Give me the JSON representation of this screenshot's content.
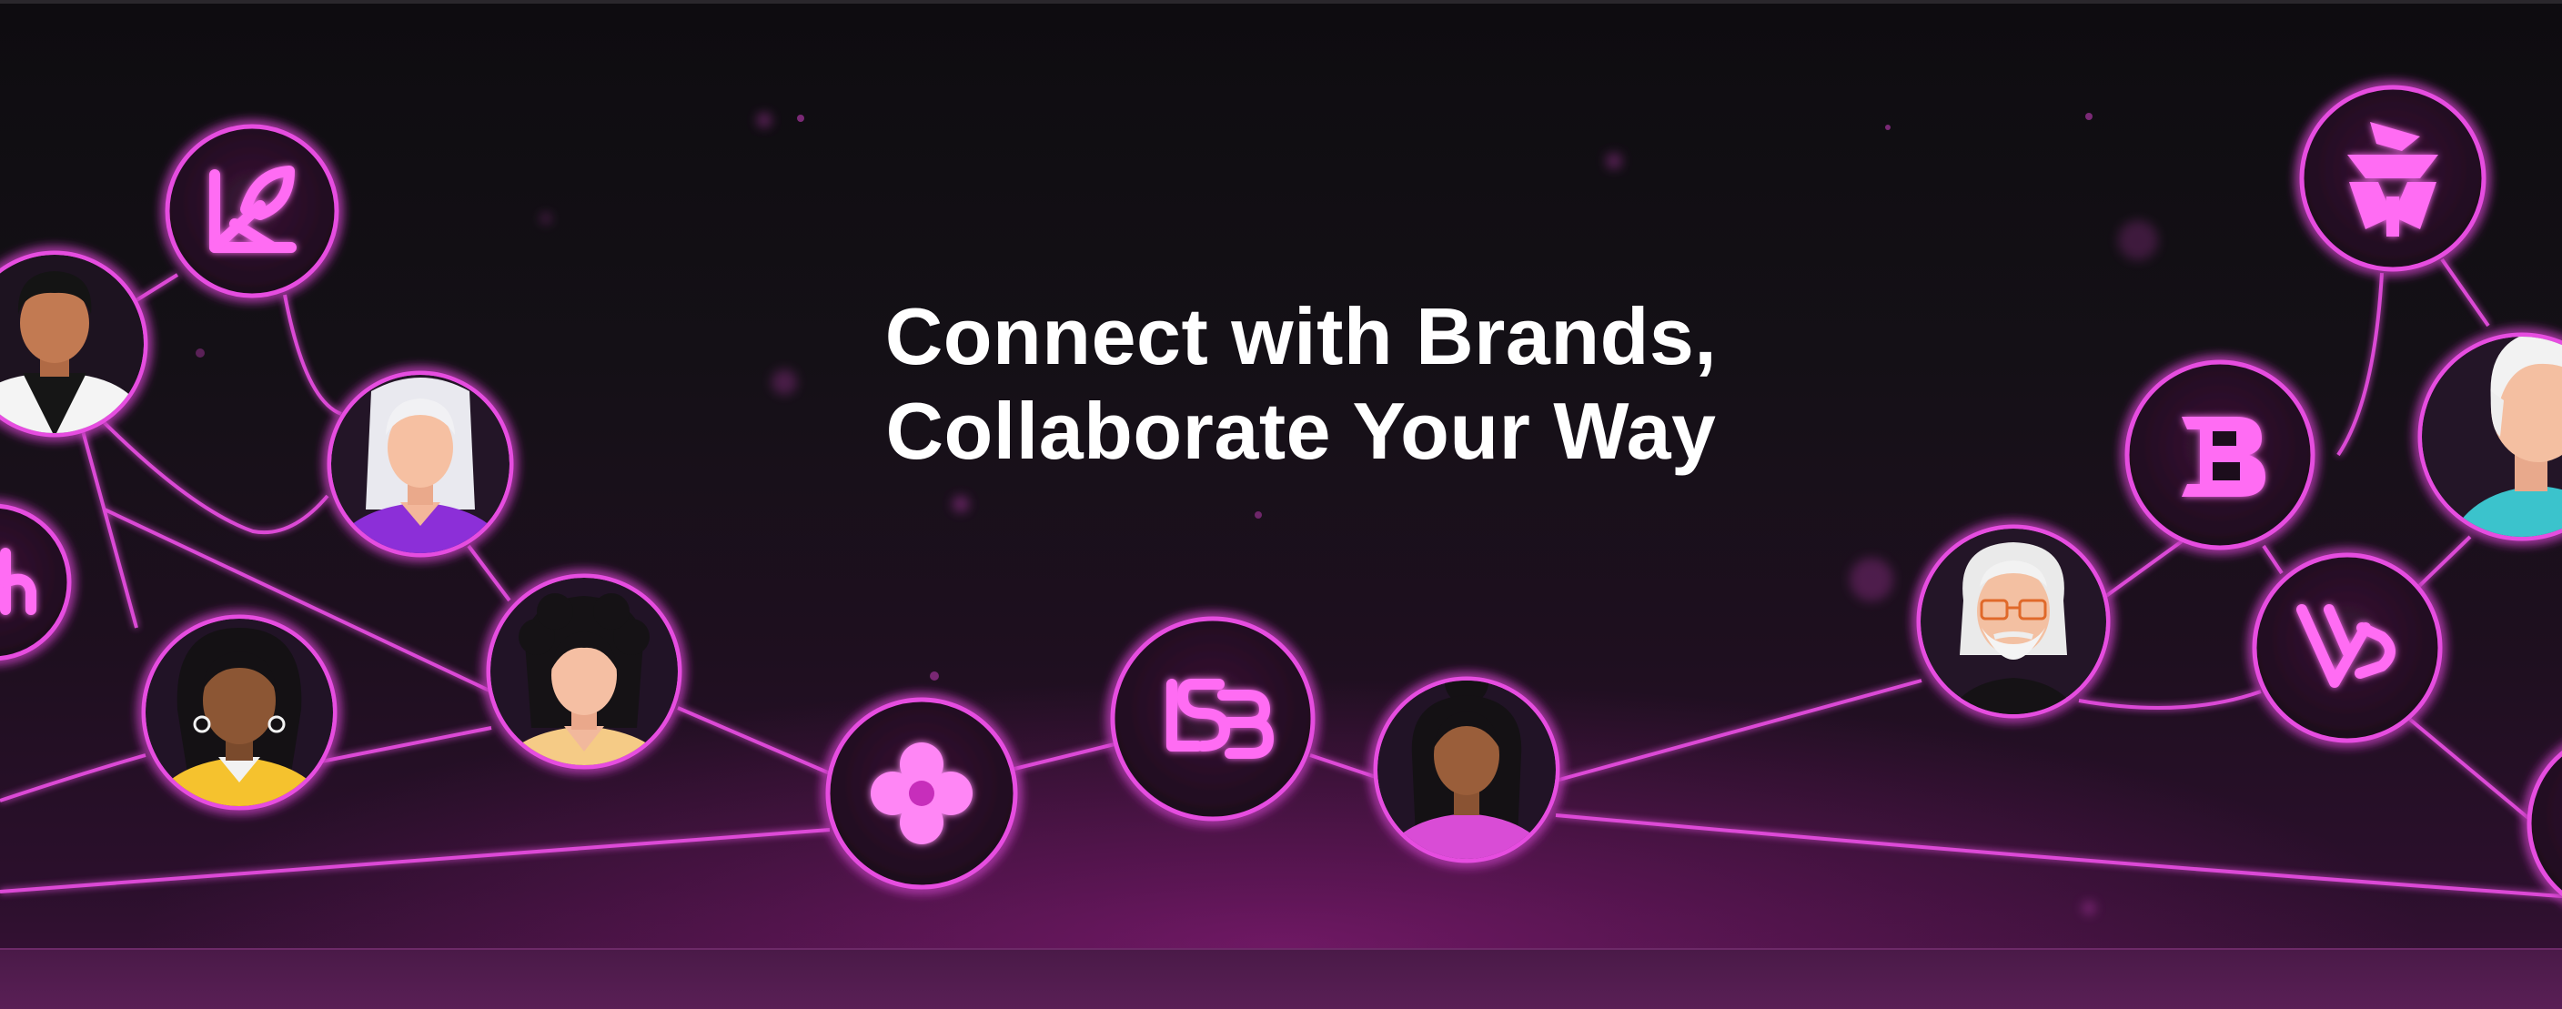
{
  "hero": {
    "headline_line1": "Connect with Brands,",
    "headline_line2": "Collaborate Your Way"
  },
  "theme": {
    "accent": "#e64ee0",
    "accent_glow": "#ff5cf5",
    "background": "#0e0c10",
    "text": "#ffffff"
  },
  "nodes": [
    {
      "name": "brand-logo-leaf-icon",
      "kind": "brand"
    },
    {
      "name": "avatar-man-dark-hair",
      "kind": "person"
    },
    {
      "name": "avatar-woman-white-hair",
      "kind": "person"
    },
    {
      "name": "brand-logo-partial-icon",
      "kind": "brand"
    },
    {
      "name": "avatar-woman-yellow-top",
      "kind": "person"
    },
    {
      "name": "avatar-woman-curly-hair",
      "kind": "person"
    },
    {
      "name": "brand-logo-flower-icon",
      "kind": "brand"
    },
    {
      "name": "brand-logo-lsb-icon",
      "kind": "brand"
    },
    {
      "name": "avatar-woman-bun-pink-top",
      "kind": "person"
    },
    {
      "name": "avatar-man-glasses-beard",
      "kind": "person"
    },
    {
      "name": "brand-logo-b-icon",
      "kind": "brand"
    },
    {
      "name": "brand-logo-triangle-icon",
      "kind": "brand"
    },
    {
      "name": "avatar-man-white-hair-teal",
      "kind": "person"
    },
    {
      "name": "brand-logo-v-icon",
      "kind": "brand"
    },
    {
      "name": "partial-node-right",
      "kind": "person"
    }
  ]
}
